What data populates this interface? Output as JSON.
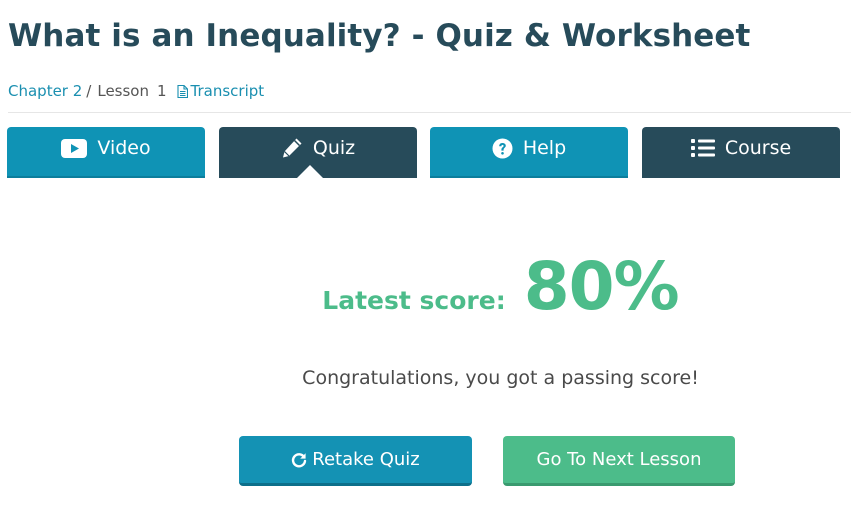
{
  "page": {
    "title": "What is an Inequality? - Quiz & Worksheet"
  },
  "breadcrumb": {
    "chapter": "Chapter 2",
    "separator": "/",
    "lesson_label": "Lesson",
    "lesson_number": "1",
    "transcript": "Transcript"
  },
  "tabs": [
    {
      "label": "Video",
      "icon": "play-icon",
      "active": false
    },
    {
      "label": "Quiz",
      "icon": "pencil-icon",
      "active": true
    },
    {
      "label": "Help",
      "icon": "question-circle-icon",
      "active": false
    },
    {
      "label": "Course",
      "icon": "list-icon",
      "active": false
    }
  ],
  "result": {
    "score_label": "Latest score:",
    "score_value": "80%",
    "message": "Congratulations, you got a passing score!"
  },
  "actions": {
    "retake_label": "Retake Quiz",
    "next_label": "Go To Next Lesson"
  },
  "colors": {
    "heading": "#274b5a",
    "link": "#1a8fb0",
    "tab_blue": "#0f93b5",
    "tab_dark": "#274b5a",
    "success_green": "#4cbc8a"
  }
}
